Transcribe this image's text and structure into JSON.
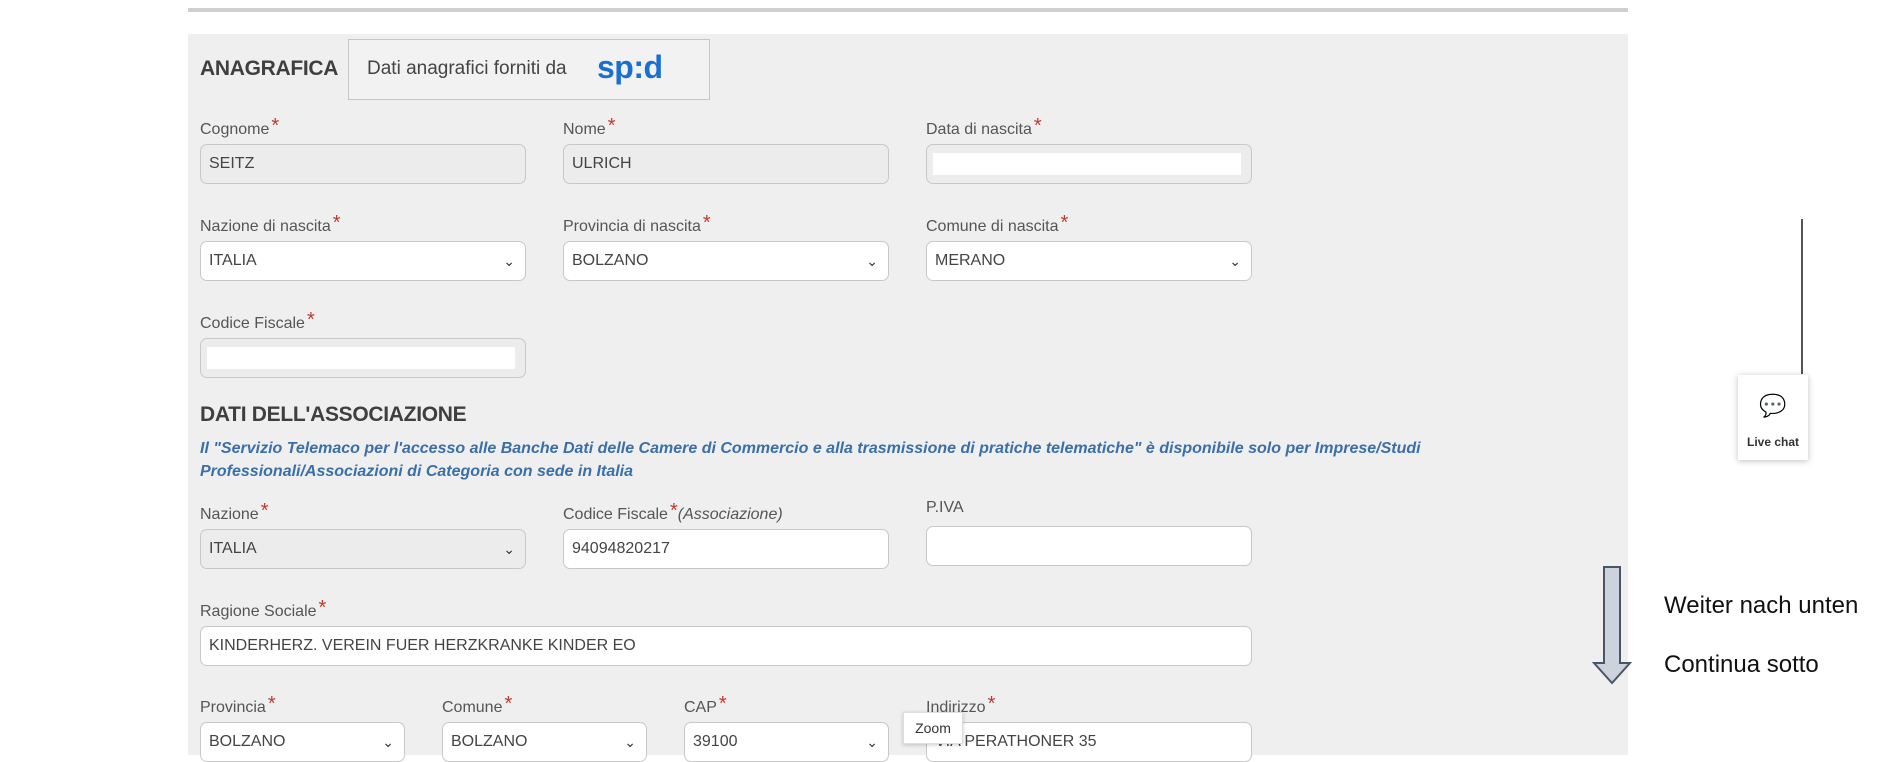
{
  "anagrafica": {
    "title": "ANAGRAFICA",
    "spid_text": "Dati anagrafici forniti da",
    "spid_logo": "sp:d",
    "cognome_label": "Cognome",
    "cognome_value": "SEITZ",
    "nome_label": "Nome",
    "nome_value": "ULRICH",
    "data_nascita_label": "Data di nascita",
    "data_nascita_value": "",
    "nazione_nascita_label": "Nazione di nascita",
    "nazione_nascita_value": "ITALIA",
    "provincia_nascita_label": "Provincia di nascita",
    "provincia_nascita_value": "BOLZANO",
    "comune_nascita_label": "Comune di nascita",
    "comune_nascita_value": "MERANO",
    "codice_fiscale_label": "Codice Fiscale",
    "codice_fiscale_value": ""
  },
  "associazione": {
    "title": "DATI DELL'ASSOCIAZIONE",
    "info": "Il \"Servizio Telemaco per l'accesso alle Banche Dati delle Camere di Commercio e alla trasmissione di pratiche telematiche\" è disponibile solo per Imprese/Studi Professionali/Associazioni di Categoria con sede in Italia",
    "nazione_label": "Nazione",
    "nazione_value": "ITALIA",
    "cf_label": "Codice Fiscale",
    "cf_suffix": "(Associazione)",
    "cf_value": "94094820217",
    "piva_label": "P.IVA",
    "piva_value": "",
    "ragione_label": "Ragione Sociale",
    "ragione_value": "KINDERHERZ. VEREIN FUER HERZKRANKE KINDER EO",
    "provincia_label": "Provincia",
    "provincia_value": "BOLZANO",
    "comune_label": "Comune",
    "comune_value": "BOLZANO",
    "cap_label": "CAP",
    "cap_value": "39100",
    "indirizzo_label": "Indirizzo",
    "indirizzo_value": "VIA PERATHONER 35"
  },
  "required_mark": "*",
  "zoom_tooltip": "Zoom",
  "live_chat": {
    "label": "Live chat",
    "icon": "chat-bubbles-icon"
  },
  "annotation": {
    "line1": "Weiter nach unten",
    "line2": "Continua sotto"
  },
  "colors": {
    "accent": "#1a6fd1",
    "required": "#c0392b",
    "info_text": "#3a6fa8"
  }
}
